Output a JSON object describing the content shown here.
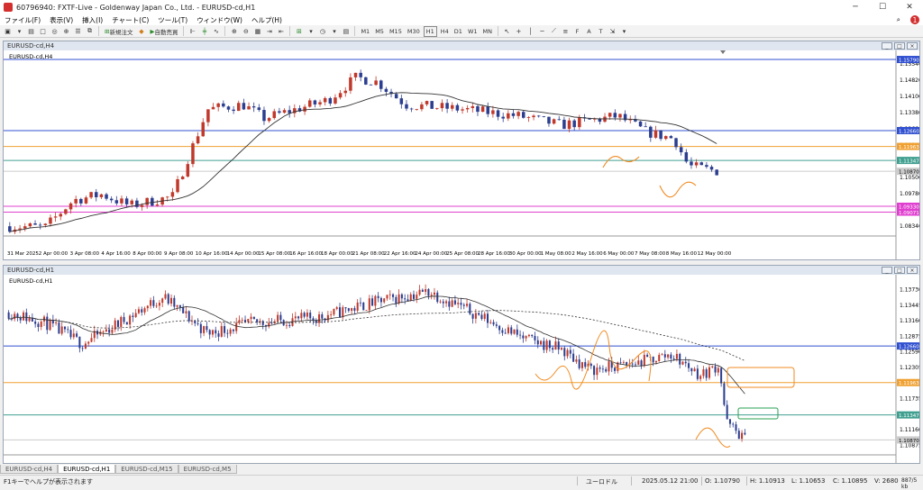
{
  "window": {
    "title": "60796940: FXTF-Live - Goldenway Japan Co., Ltd. - EURUSD-cd,H1"
  },
  "menu": [
    "ファイル(F)",
    "表示(V)",
    "挿入(I)",
    "チャート(C)",
    "ツール(T)",
    "ウィンドウ(W)",
    "ヘルプ(H)"
  ],
  "notifications": "1",
  "toolbar": {
    "new_order": "新規注文",
    "auto_trade": "自動売買",
    "timeframes": [
      "M1",
      "M5",
      "M15",
      "M30",
      "H1",
      "H4",
      "D1",
      "W1",
      "MN"
    ]
  },
  "h4": {
    "header": "EURUSD-cd,H4",
    "inner_label": "EURUSD-cd,H4",
    "price_ticks": [
      "1.15540",
      "1.14820",
      "1.14100",
      "1.13380",
      "1.12660",
      "1.11940",
      "1.11220",
      "1.10500",
      "1.09780",
      "1.09060",
      "1.08340"
    ],
    "line_labels": {
      "blue_top": "1.15790",
      "blue_mid": "1.12660",
      "orange": "1.11963",
      "teal": "1.11347",
      "current": "1.10870",
      "magenta1": "1.09330",
      "magenta2": "1.09071"
    },
    "time_labels": [
      "31 Mar 2025",
      "2 Apr 00:00",
      "3 Apr 08:00",
      "4 Apr 16:00",
      "8 Apr 00:00",
      "9 Apr 08:00",
      "10 Apr 16:00",
      "14 Apr 00:00",
      "15 Apr 08:00",
      "16 Apr 16:00",
      "18 Apr 00:00",
      "21 Apr 08:00",
      "22 Apr 16:00",
      "24 Apr 00:00",
      "25 Apr 08:00",
      "28 Apr 16:00",
      "30 Apr 00:00",
      "1 May 08:00",
      "2 May 16:00",
      "6 May 00:00",
      "7 May 08:00",
      "8 May 16:00",
      "12 May 00:00"
    ]
  },
  "h1": {
    "header": "EURUSD-cd,H1",
    "inner_label": "EURUSD-cd,H1",
    "price_ticks": [
      "1.13730",
      "1.13445",
      "1.13160",
      "1.12875",
      "1.12590",
      "1.12305",
      "1.12020",
      "1.11735",
      "1.11445",
      "1.11160",
      "1.10875"
    ],
    "line_labels": {
      "blue": "1.12660",
      "orange": "1.11963",
      "teal": "1.11347",
      "current": "1.10870"
    }
  },
  "tabs": [
    "EURUSD-cd,H4",
    "EURUSD-cd,H1",
    "EURUSD-cd,M15",
    "EURUSD-cd,M5"
  ],
  "active_tab": 1,
  "status": {
    "help": "F1キーでヘルプが表示されます",
    "profile": "ユーロドル",
    "datetime": "2025.05.12 21:00",
    "open": "O: 1.10790",
    "high": "H: 1.10913",
    "low": "L: 1.10653",
    "close": "C: 1.10895",
    "volume": "V: 2680",
    "traffic": "887/5 kb"
  },
  "colors": {
    "bull": "#c0392b",
    "bear": "#2c3e8f",
    "blue_line": "#3050d0",
    "orange_line": "#f0a030",
    "teal_line": "#40a090",
    "magenta_line": "#e040d0",
    "ma_line": "#333333"
  }
}
